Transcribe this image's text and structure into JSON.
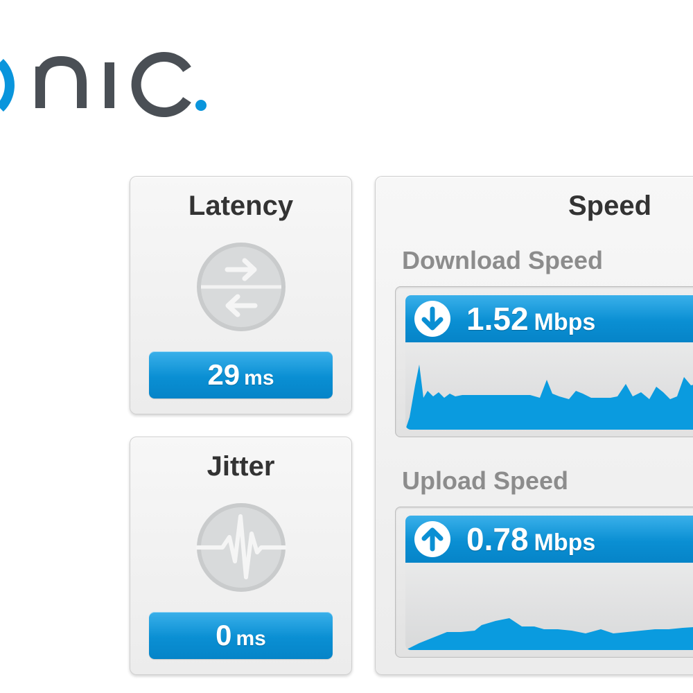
{
  "brand": {
    "logo_text": "onic.",
    "accent_color": "#0a95dc",
    "text_color": "#4a4f55"
  },
  "latency": {
    "title": "Latency",
    "icon": "latency-arrows-icon",
    "value": "29",
    "unit": "ms"
  },
  "jitter": {
    "title": "Jitter",
    "icon": "heartbeat-wave-icon",
    "value": "0",
    "unit": "ms"
  },
  "speed": {
    "title": "Speed",
    "download": {
      "label": "Download Speed",
      "icon": "arrow-down-circle-icon",
      "value": "1.52",
      "unit": "Mbps"
    },
    "upload": {
      "label": "Upload Speed",
      "icon": "arrow-up-circle-icon",
      "value": "0.78",
      "unit": "Mbps"
    }
  }
}
